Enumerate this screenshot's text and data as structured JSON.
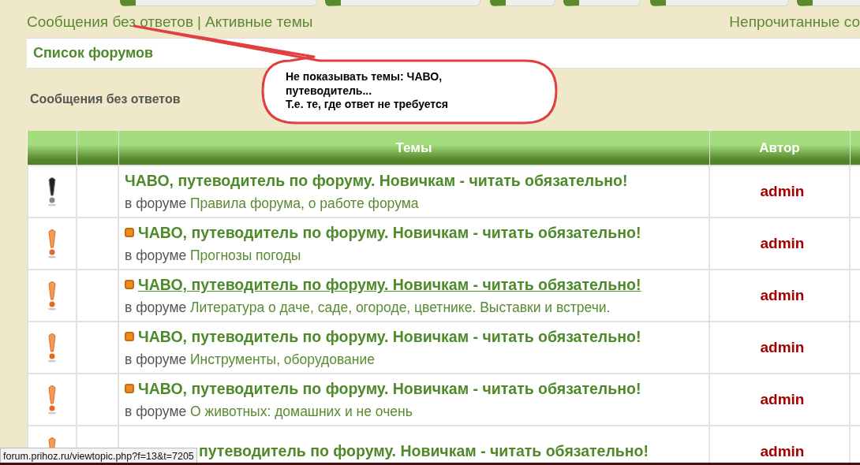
{
  "nav_links": {
    "left": [
      {
        "label": "Сообщения без ответов"
      },
      {
        "label": "Активные темы"
      }
    ],
    "separator": "|",
    "right": "Непрочитанные со"
  },
  "breadcrumb": "Список форумов",
  "page_title": "Сообщения без ответов",
  "callout": {
    "lines": [
      "Не показывать темы: ЧАВО,",
      "путеводитель...",
      "Т.е. те, где ответ не требуется"
    ]
  },
  "table": {
    "columns": [
      "Темы",
      "Автор"
    ],
    "rows": [
      {
        "kind": "global",
        "title": "ЧАВО, путеводитель по форуму. Новичкам - читать обязательно!",
        "hovered": false,
        "prefix": "в форуме",
        "forum": "Правила форума, о работе форума",
        "author": "admin"
      },
      {
        "kind": "announce",
        "title": "ЧАВО, путеводитель по форуму. Новичкам - читать обязательно!",
        "hovered": false,
        "prefix": "в форуме",
        "forum": "Прогнозы погоды",
        "author": "admin"
      },
      {
        "kind": "announce",
        "title": "ЧАВО, путеводитель по форуму. Новичкам - читать обязательно!",
        "hovered": true,
        "prefix": "в форуме",
        "forum": "Литература о даче, саде, огороде, цветнике. Выставки и встречи.",
        "author": "admin"
      },
      {
        "kind": "announce",
        "title": "ЧАВО, путеводитель по форуму. Новичкам - читать обязательно!",
        "hovered": false,
        "prefix": "в форуме",
        "forum": "Инструменты, оборудование",
        "author": "admin"
      },
      {
        "kind": "announce",
        "title": "ЧАВО, путеводитель по форуму. Новичкам - читать обязательно!",
        "hovered": false,
        "prefix": "в форуме",
        "forum": "О животных: домашних и не очень",
        "author": "admin"
      },
      {
        "kind": "announce",
        "covered": true,
        "title": "путеводитель по форуму. Новичкам - читать обязательно!",
        "hovered": false,
        "author": "admin"
      }
    ]
  },
  "status_url": "forum.prihoz.ru/viewtopic.php?f=13&t=7205"
}
